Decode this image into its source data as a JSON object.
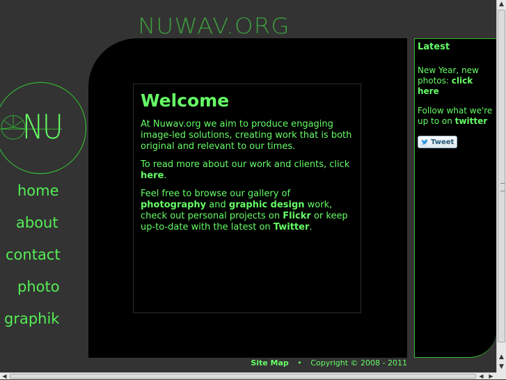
{
  "site": {
    "title": "NUWAV.ORG",
    "logo_text": "NU"
  },
  "nav": [
    {
      "label": "home"
    },
    {
      "label": "about"
    },
    {
      "label": "contact"
    },
    {
      "label": "photo"
    },
    {
      "label": "graphik"
    }
  ],
  "main": {
    "heading": "Welcome",
    "p1": "At Nuwav.org we aim to produce engaging image-led solutions, creating work that is both original and relevant to our times.",
    "p2_text": "To read more about our work and clients, click ",
    "p2_link": "here",
    "p2_end": ".",
    "p3_a": "Feel free to browse our gallery of ",
    "p3_link1": "photography",
    "p3_b": " and ",
    "p3_link2": "graphic design",
    "p3_c": " work, check out personal projects on ",
    "p3_link3": "Flickr",
    "p3_d": " or keep up-to-date with the latest on ",
    "p3_link4": "Twitter",
    "p3_e": "."
  },
  "sidebar": {
    "heading": "Latest",
    "item1_text": "New Year, new photos: ",
    "item1_link": "click here",
    "item2_text": "Follow what we're up to on ",
    "item2_link": "twitter",
    "tweet_label": "Tweet"
  },
  "footer": {
    "sitemap": "Site Map",
    "separator": "•",
    "copyright": "Copyright © 2008 - 2011"
  }
}
